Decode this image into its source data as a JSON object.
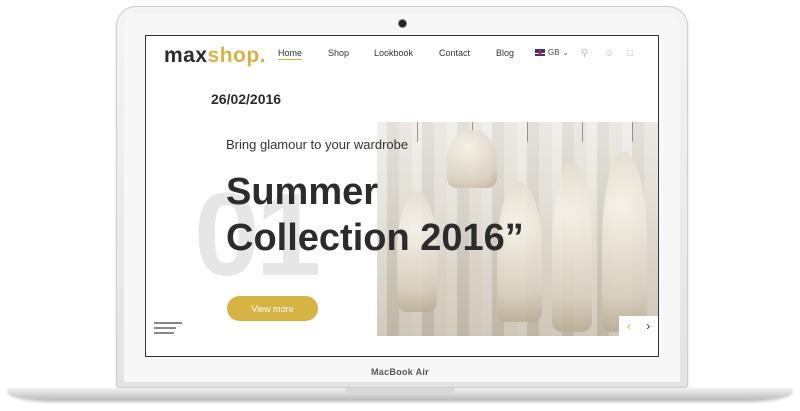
{
  "device": {
    "model_label": "MacBook Air"
  },
  "site": {
    "logo": {
      "part1": "max",
      "part2": "shop."
    },
    "nav": [
      {
        "label": "Home",
        "active": true
      },
      {
        "label": "Shop",
        "active": false
      },
      {
        "label": "Lookbook",
        "active": false
      },
      {
        "label": "Contact",
        "active": false
      },
      {
        "label": "Blog",
        "active": false
      }
    ],
    "language": {
      "code": "GB",
      "icon": "uk-flag-icon"
    },
    "top_icons": [
      "search-icon",
      "user-icon",
      "bag-icon"
    ]
  },
  "hero": {
    "date": "26/02/2016",
    "slide_number": "01",
    "tagline": "Bring glamour to your wardrobe",
    "headline_line1": "Summer",
    "headline_line2": "Collection 2016”",
    "cta_label": "View more"
  },
  "colors": {
    "accent": "#d6b343",
    "text": "#2c2c2c"
  }
}
